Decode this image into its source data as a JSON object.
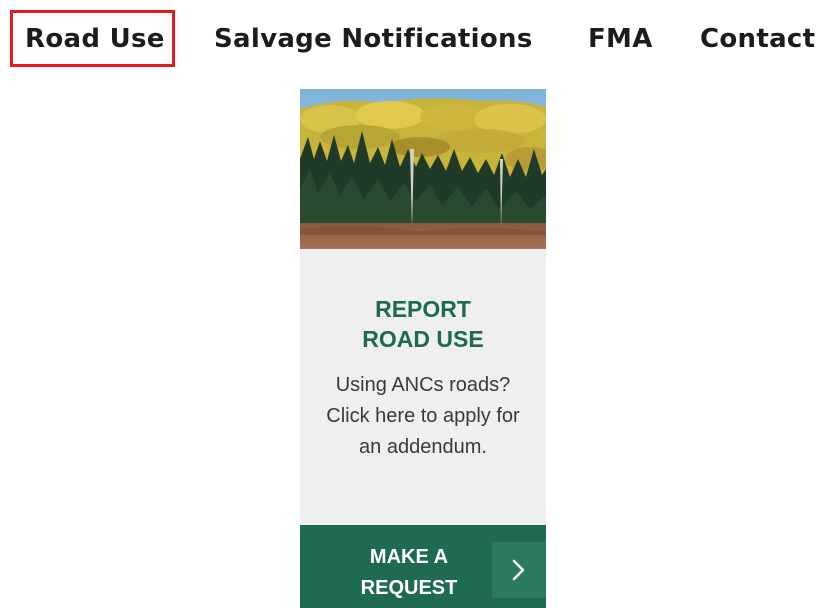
{
  "nav": {
    "items": [
      {
        "label": "Road Use",
        "highlighted": true
      },
      {
        "label": "Salvage Notifications"
      },
      {
        "label": "FMA"
      },
      {
        "label": "Contact"
      }
    ],
    "highlight_color": "#e3191b"
  },
  "card": {
    "image_icon": "forest-image",
    "title_line1": "REPORT",
    "title_line2": "ROAD USE",
    "description": "Using ANCs roads? Click here to apply for an addendum.",
    "button": {
      "label_line1": "MAKE A",
      "label_line2": "REQUEST",
      "icon": "chevron-right-icon"
    },
    "colors": {
      "title": "#1c6b4c",
      "button_bg": "#1f6b4f",
      "card_bg": "#efefef"
    }
  }
}
